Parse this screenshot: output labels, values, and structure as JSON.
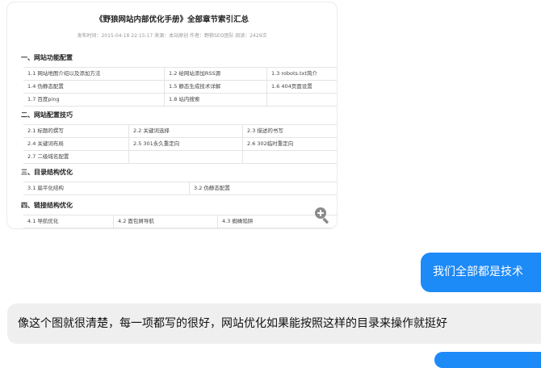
{
  "document": {
    "title": "《野狼网站内部优化手册》全部章节索引汇总",
    "meta": "发布时间：2015-04-18 22:15:17 来源：本站原创 作者：野狼SEO团队 阅读：2429次",
    "sections": [
      {
        "heading": "一、网站功能配置",
        "rows": [
          [
            "1.1 网站地图介绍以及添加方法",
            "1.2 给网站添加RSS源",
            "1.3 robots.txt简介"
          ],
          [
            "1.4 伪静态配置",
            "1.5 静态生成技术详解",
            "1.6 404页面设置"
          ],
          [
            "1.7 百度ping",
            "1.8 站内搜索",
            ""
          ]
        ]
      },
      {
        "heading": "二、网站配置技巧",
        "rows": [
          [
            "2.1 标题的撰写",
            "2.2 关键词选择",
            "2.3 描述的书写"
          ],
          [
            "2.4 关键词布局",
            "2.5 301永久重定向",
            "2.6 302临时重定向"
          ],
          [
            "2.7 二级域名配置",
            "",
            ""
          ]
        ]
      },
      {
        "heading": "三、目录结构优化",
        "rows": [
          [
            "3.1 扁平化结构",
            "3.2 伪静态配置"
          ]
        ]
      },
      {
        "heading": "四、链接结构优化",
        "rows": [
          [
            "4.1 导航优化",
            "4.2 面包屑导航",
            "4.3 蜘蛛陷阱"
          ]
        ]
      }
    ],
    "zoom_icon": "zoom-in-icon"
  },
  "chat": {
    "outgoing": "我们全部都是技术",
    "incoming": "像这个图就很清楚，每一项都写的很好，网站优化如果能按照这样的目录来操作就挺好",
    "accent_color": "#1c8af7",
    "incoming_bg": "#efefef"
  }
}
